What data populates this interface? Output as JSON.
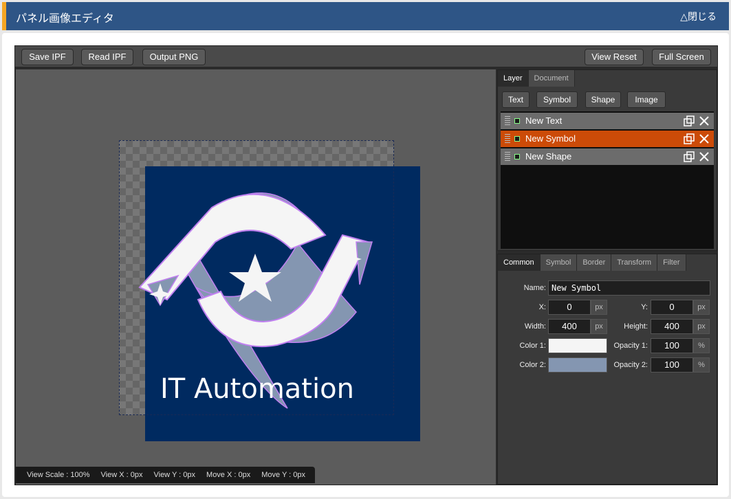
{
  "window": {
    "title": "パネル画像エディタ",
    "close_label": "△閉じる"
  },
  "toolbar": {
    "save_ipf": "Save IPF",
    "read_ipf": "Read IPF",
    "output_png": "Output PNG",
    "view_reset": "View Reset",
    "full_screen": "Full Screen"
  },
  "canvas": {
    "text_layer": "IT Automation",
    "colors": {
      "background": "#5c5c5c",
      "shape_fill": "#002a60",
      "symbol_color_1": "#f5f5f5",
      "symbol_color_2": "#8496b1",
      "symbol_outline": "#c080f0"
    }
  },
  "status": {
    "view_scale": "View Scale : 100%",
    "view_x": "View X : 0px",
    "view_y": "View Y : 0px",
    "move_x": "Move X : 0px",
    "move_y": "Move Y : 0px"
  },
  "layer_panel": {
    "tabs": [
      "Layer",
      "Document"
    ],
    "active_tab": "Layer",
    "add_buttons": [
      "Text",
      "Symbol",
      "Shape",
      "Image"
    ],
    "layers": [
      {
        "name": "New Text",
        "selected": false
      },
      {
        "name": "New Symbol",
        "selected": true
      },
      {
        "name": "New Shape",
        "selected": false
      }
    ]
  },
  "properties": {
    "tabs": [
      "Common",
      "Symbol",
      "Border",
      "Transform",
      "Filter"
    ],
    "active_tab": "Common",
    "name_label": "Name:",
    "name_value": "New Symbol",
    "x_label": "X:",
    "x_value": "0",
    "y_label": "Y:",
    "y_value": "0",
    "width_label": "Width:",
    "width_value": "400",
    "height_label": "Height:",
    "height_value": "400",
    "color1_label": "Color 1:",
    "color1_value": "#f5f5f5",
    "opacity1_label": "Opacity 1:",
    "opacity1_value": "100",
    "color2_label": "Color 2:",
    "color2_value": "#8496b1",
    "opacity2_label": "Opacity 2:",
    "opacity2_value": "100",
    "unit_px": "px",
    "unit_percent": "%"
  }
}
